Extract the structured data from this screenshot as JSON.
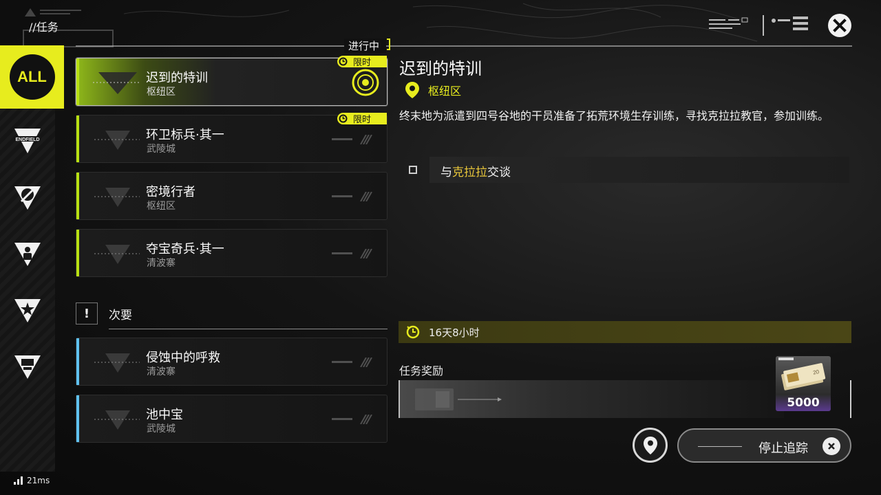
{
  "header": {
    "breadcrumb": "//任务",
    "in_progress_label": "进行中",
    "close_icon": "close-icon"
  },
  "sidebar": {
    "items": [
      {
        "label": "ALL",
        "icon": "all-badge",
        "active": true
      },
      {
        "label": "ENDFIELD",
        "icon": "endfield-icon"
      },
      {
        "label": "",
        "icon": "sword-icon"
      },
      {
        "label": "",
        "icon": "person-icon"
      },
      {
        "label": "",
        "icon": "star-icon"
      },
      {
        "label": "",
        "icon": "box-icon"
      }
    ]
  },
  "main_quests": [
    {
      "title": "迟到的特训",
      "area": "枢纽区",
      "limited": "限时",
      "selected": true,
      "tracked": true
    },
    {
      "title": "环卫标兵·其一",
      "area": "武陵城",
      "limited": "限时"
    },
    {
      "title": "密境行者",
      "area": "枢纽区"
    },
    {
      "title": "夺宝奇兵·其一",
      "area": "清波寨"
    }
  ],
  "secondary": {
    "icon_glyph": "!",
    "title": "次要",
    "quests": [
      {
        "title": "侵蚀中的呼救",
        "area": "清波寨"
      },
      {
        "title": "池中宝",
        "area": "武陵城"
      }
    ]
  },
  "detail": {
    "title": "迟到的特训",
    "location": "枢纽区",
    "description": "终末地为派遣到四号谷地的干员准备了拓荒环境生存训练，寻找克拉拉教官，参加训练。",
    "objective_pre": "与",
    "objective_highlight": "克拉拉",
    "objective_post": "交谈",
    "timer": "16天8小时",
    "reward_label": "任务奖励",
    "reward_quantity": "5000",
    "stop_tracking": "停止追踪"
  },
  "status": {
    "ping": "21ms"
  },
  "colors": {
    "accent": "#e7ec1e",
    "main_bar": "#b8e012",
    "side_bar": "#5fc2f0",
    "highlight": "#e7c53a"
  }
}
